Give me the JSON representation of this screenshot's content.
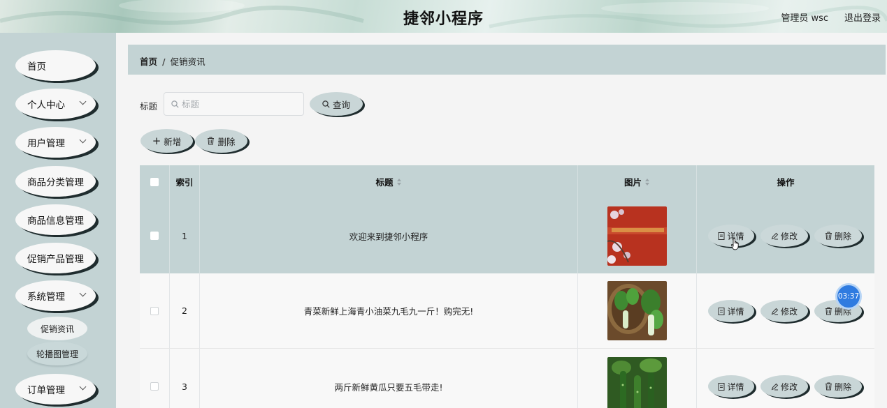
{
  "header": {
    "title": "捷邻小程序",
    "user": "管理员 wsc",
    "logout": "退出登录"
  },
  "sidebar": {
    "items": [
      {
        "label": "首页",
        "has_chevron": false
      },
      {
        "label": "个人中心",
        "has_chevron": true
      },
      {
        "label": "用户管理",
        "has_chevron": true
      },
      {
        "label": "商品分类管理",
        "has_chevron": false
      },
      {
        "label": "商品信息管理",
        "has_chevron": false
      },
      {
        "label": "促销产品管理",
        "has_chevron": false
      },
      {
        "label": "系统管理",
        "has_chevron": true
      },
      {
        "label": "订单管理",
        "has_chevron": true
      }
    ],
    "submenu": [
      {
        "label": "促销资讯",
        "active": true
      },
      {
        "label": "轮播图管理",
        "active": false
      }
    ]
  },
  "breadcrumb": {
    "home": "首页",
    "separator": "/",
    "current": "促销资讯"
  },
  "search": {
    "label": "标题",
    "placeholder": "标题",
    "value": "",
    "button": "查询"
  },
  "actions": {
    "add": "新增",
    "delete": "删除"
  },
  "table": {
    "headers": {
      "index": "索引",
      "title": "标题",
      "image": "图片",
      "ops": "操作"
    },
    "rows": [
      {
        "index": "1",
        "title": "欢迎来到捷邻小程序",
        "image": "red-banner-flowers"
      },
      {
        "index": "2",
        "title": "青菜新鲜上海青小油菜九毛九一斤！购完无!",
        "image": "bok-choy-basket"
      },
      {
        "index": "3",
        "title": "两斤新鲜黄瓜只要五毛带走!",
        "image": "cucumbers"
      }
    ],
    "op_labels": {
      "detail": "详情",
      "edit": "修改",
      "delete": "删除"
    }
  },
  "overlay": {
    "timer": "03:37"
  },
  "colors": {
    "panel": "#c3d3d4",
    "pill_shadow": "#1f2c2e",
    "timer": "#2f7be0"
  }
}
